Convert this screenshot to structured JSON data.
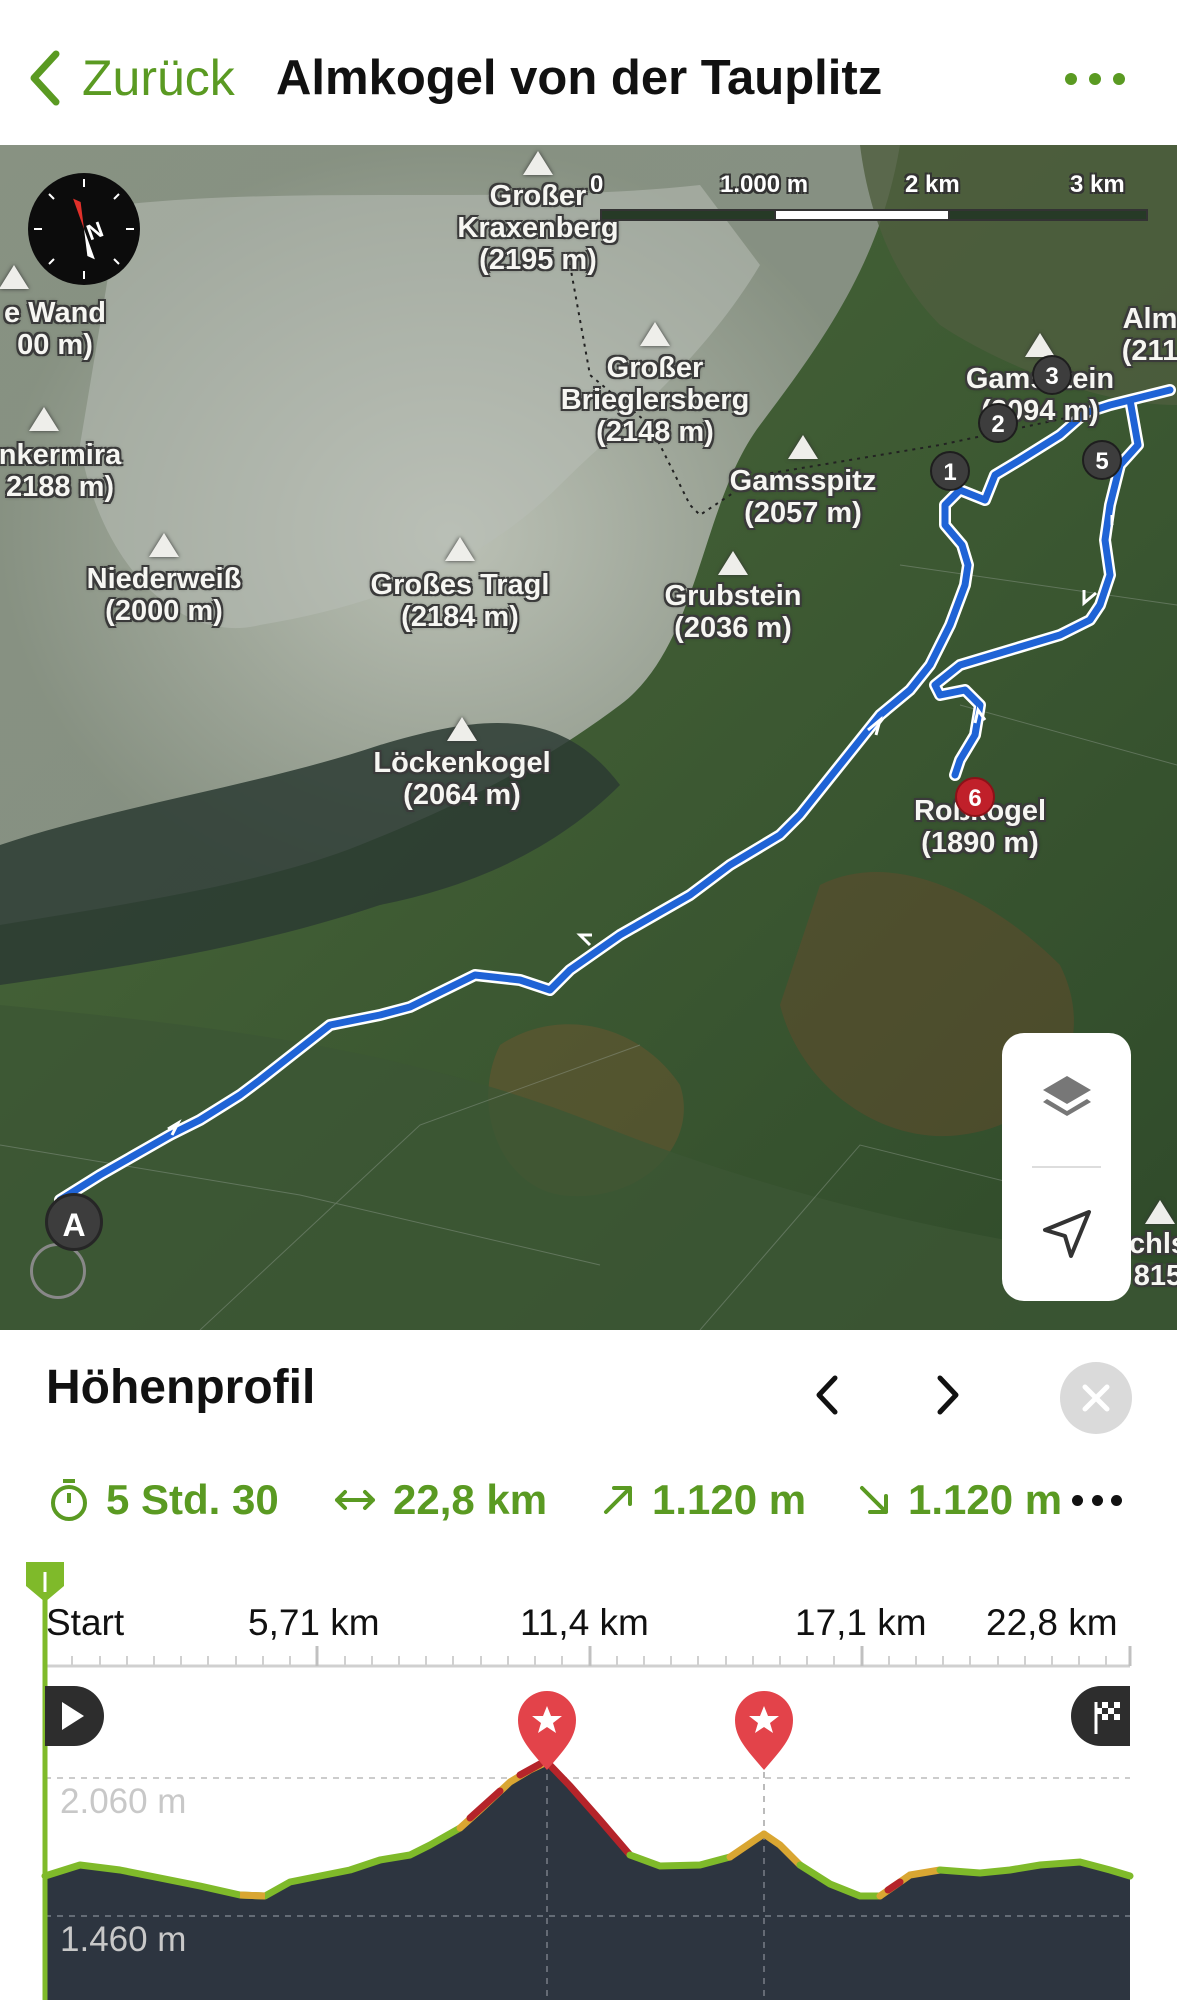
{
  "header": {
    "back_label": "Zurück",
    "title": "Almkogel von der Tauplitz"
  },
  "map": {
    "peaks": [
      {
        "name": "Großer",
        "name2": "Kraxenberg",
        "elev": "(2195 m)"
      },
      {
        "name": "e Wand",
        "elev": "00 m)"
      },
      {
        "name": "Großer",
        "name2": "Brieglersberg",
        "elev": "(2148 m)"
      },
      {
        "name": "nkermira",
        "elev": "2188 m)"
      },
      {
        "name": "Gamsspitz",
        "elev": "(2057 m)"
      },
      {
        "name": "Niederweiß",
        "elev": "(2000 m)"
      },
      {
        "name": "Großes Tragl",
        "elev": "(2184 m)"
      },
      {
        "name": "Grubstein",
        "elev": "(2036 m)"
      },
      {
        "name": "Löckenkogel",
        "elev": "(2064 m)"
      },
      {
        "name": "Roßkogel",
        "elev": "(1890 m)"
      },
      {
        "name": "Gamsstein",
        "elev": "(2094 m)"
      },
      {
        "name": "Alm",
        "elev": "(211"
      },
      {
        "name": "chls",
        "elev": "815"
      }
    ],
    "scale_labels": [
      "0",
      "1.000 m",
      "2 km",
      "3 km"
    ],
    "waypoints": [
      "1",
      "2",
      "3",
      "5",
      "6"
    ],
    "start_marker": "A",
    "layers_icon": "layers-icon",
    "locate_icon": "location-arrow-icon"
  },
  "profile": {
    "title": "Höhenprofil",
    "stats": {
      "duration": "5 Std. 30",
      "distance": "22,8 km",
      "ascent": "1.120 m",
      "descent": "1.120 m"
    },
    "km_labels": [
      "Start",
      "5,71 km",
      "11,4 km",
      "17,1 km",
      "22,8 km"
    ],
    "elev_labels": [
      "2.060 m",
      "1.460 m"
    ],
    "colors": {
      "accent": "#5a9a22",
      "fill": "#2d3540",
      "steep": "#b5242a",
      "medium": "#d9a632"
    }
  }
}
